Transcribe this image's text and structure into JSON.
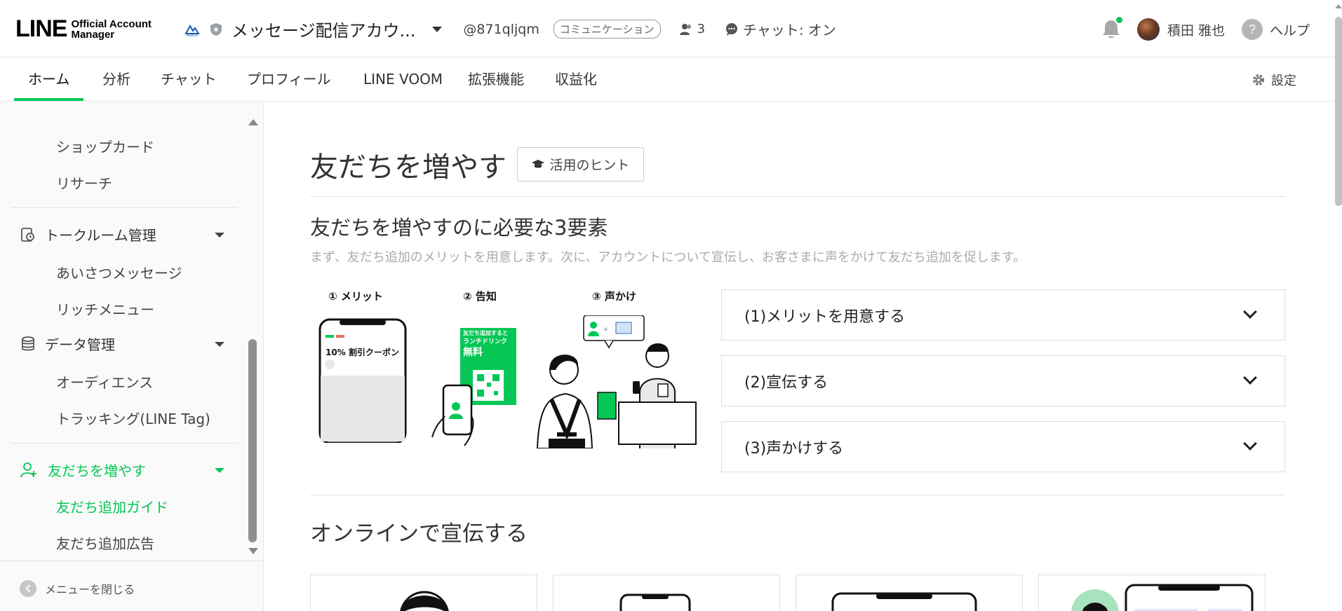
{
  "header": {
    "logo_main": "LINE",
    "logo_sub_1": "Official Account",
    "logo_sub_2": "Manager",
    "account_name": "メッセージ配信アカウ...",
    "account_id": "@871qljqm",
    "plan_badge": "コミュニケーション",
    "friend_count": "3",
    "chat_status": "チャット: オン",
    "user_name": "積田 雅也",
    "help_label": "ヘルプ",
    "notification_dot_color": "#06c755"
  },
  "nav": {
    "tabs": [
      {
        "label": "ホーム",
        "active": true
      },
      {
        "label": "分析"
      },
      {
        "label": "チャット"
      },
      {
        "label": "プロフィール"
      },
      {
        "label": "LINE VOOM"
      },
      {
        "label": "拡張機能"
      },
      {
        "label": "収益化"
      }
    ],
    "settings_label": "設定",
    "accent_color": "#06c755"
  },
  "sidebar": {
    "items_top": [
      "ショップカード",
      "リサーチ"
    ],
    "group_talkroom": {
      "label": "トークルーム管理",
      "items": [
        "あいさつメッセージ",
        "リッチメニュー"
      ]
    },
    "group_data": {
      "label": "データ管理",
      "items": [
        "オーディエンス",
        "トラッキング(LINE Tag)"
      ]
    },
    "group_friends": {
      "label": "友だちを増やす",
      "items": [
        "友だち追加ガイド",
        "友だち追加広告"
      ],
      "active_item": "友だち追加ガイド"
    },
    "close_menu": "メニューを閉じる"
  },
  "main": {
    "title": "友だちを増やす",
    "hint_button": "活用のヒント",
    "subtitle": "友だちを増やすのに必要な3要素",
    "description": "まず、友だち追加のメリットを用意します。次に、アカウントについて宣伝し、お客さまに声をかけて友だち追加を促します。",
    "illustration": {
      "step1": "① メリット",
      "step2": "② 告知",
      "step3": "③ 声かけ",
      "coupon_text": "10% 割引クーポン",
      "poster_line1": "友だち追加すると",
      "poster_line2": "ランチドリンク",
      "poster_line3": "無料"
    },
    "accordion": [
      "(1)メリットを用意する",
      "(2)宣伝する",
      "(3)声かけする"
    ],
    "section_online": "オンラインで宣伝する"
  }
}
